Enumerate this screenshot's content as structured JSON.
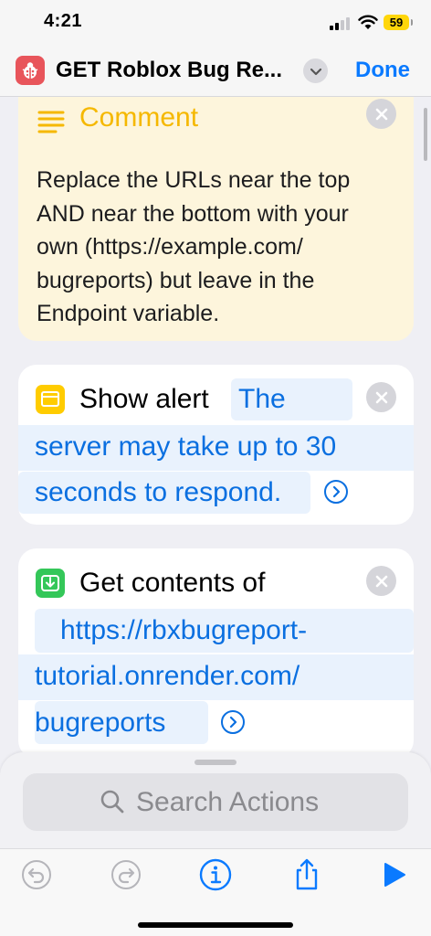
{
  "status_bar": {
    "time": "4:21",
    "battery": "59"
  },
  "nav": {
    "title": "GET Roblox Bug Re...",
    "done_label": "Done"
  },
  "comment": {
    "title": "Comment",
    "lines": [
      "Replace the URLs near the top",
      "AND near the bottom with your",
      "own (https://example.com/",
      "bugreports) but leave in the",
      "Endpoint variable."
    ]
  },
  "show_alert": {
    "label": "Show alert",
    "message_lines": [
      "The",
      "server may take up to 30",
      "seconds to respond."
    ]
  },
  "get_contents": {
    "label": "Get contents of",
    "url_lines": [
      "https://rbxbugreport-",
      "tutorial.onrender.com/",
      "bugreports"
    ]
  },
  "search": {
    "placeholder": "Search Actions"
  },
  "colors": {
    "accent": "#0a7aff",
    "comment_title": "#f5b800",
    "comment_bg": "#fdf5dc",
    "alert_icon": "#ffcc00",
    "contents_icon": "#34c759",
    "app_icon": "#e8555b"
  },
  "icons": {
    "app": "ladybug-icon",
    "comment": "lines-icon",
    "alert": "window-icon",
    "contents": "download-icon",
    "toolbar": [
      "undo-icon",
      "redo-icon",
      "info-icon",
      "share-icon",
      "play-icon"
    ]
  }
}
